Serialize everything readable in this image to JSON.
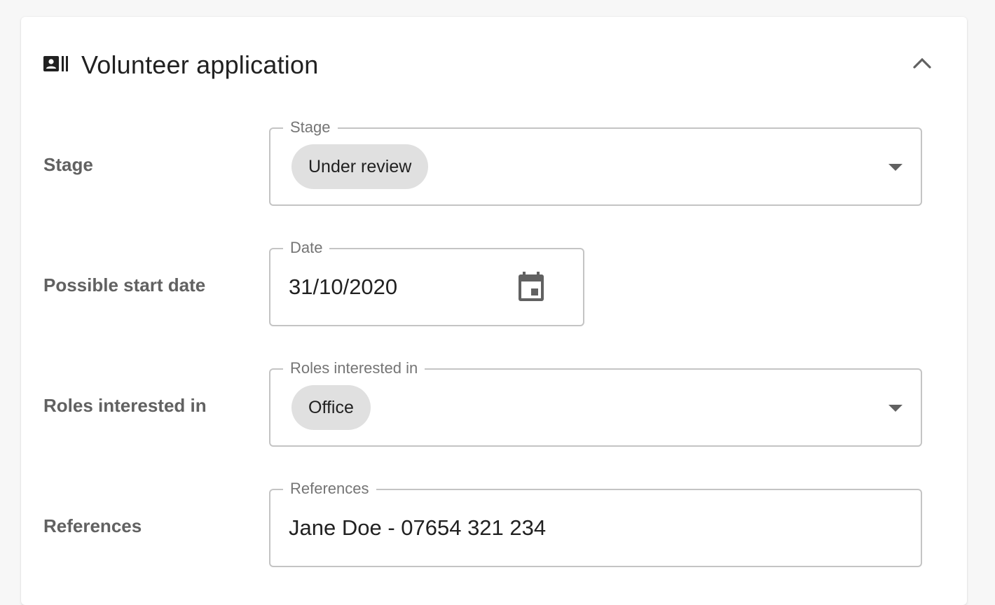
{
  "card": {
    "title": "Volunteer application",
    "header_icon": "contact-card-icon",
    "collapse_icon": "chevron-up-icon"
  },
  "rows": {
    "stage": {
      "label": "Stage",
      "legend": "Stage",
      "chip": "Under review"
    },
    "start_date": {
      "label": "Possible start date",
      "legend": "Date",
      "value": "31/10/2020",
      "icon": "calendar-icon"
    },
    "roles": {
      "label": "Roles interested in",
      "legend": "Roles interested in",
      "chip": "Office"
    },
    "references": {
      "label": "References",
      "legend": "References",
      "value": "Jane Doe - 07654 321 234"
    }
  },
  "colors": {
    "text": "#212121",
    "label": "#616161",
    "border": "#c4c4c4",
    "chip_bg": "#e0e0e0",
    "icon": "#616161"
  }
}
